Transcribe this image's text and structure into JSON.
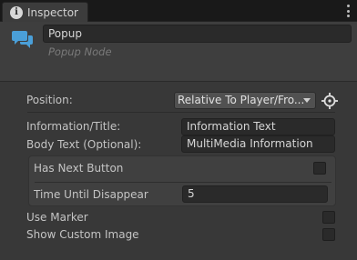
{
  "tab": {
    "icon": "info-icon",
    "label": "Inspector"
  },
  "header": {
    "icon": "chat-bubbles-icon",
    "name_value": "Popup",
    "subtitle": "Popup Node"
  },
  "fields": {
    "position": {
      "label": "Position:",
      "value": "Relative To Player/Fro..."
    },
    "information_title": {
      "label": "Information/Title:",
      "value": "Information Text"
    },
    "body_text": {
      "label": "Body Text (Optional):",
      "value": "MultiMedia Information"
    },
    "has_next_button": {
      "label": "Has Next Button",
      "checked": false
    },
    "time_until_disappear": {
      "label": "Time Until Disappear",
      "value": "5"
    },
    "use_marker": {
      "label": "Use Marker",
      "checked": false
    },
    "show_custom_image": {
      "label": "Show Custom Image",
      "checked": false
    }
  },
  "colors": {
    "accent_icon": "#4a9fd8",
    "panel": "#383838",
    "field": "#2a2a2a"
  }
}
